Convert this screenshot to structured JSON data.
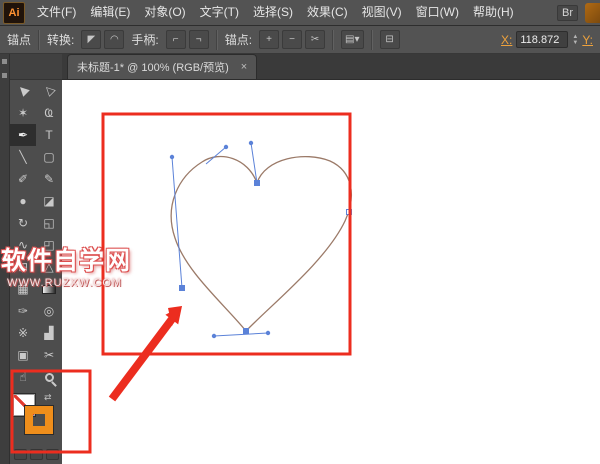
{
  "app": {
    "logo": "Ai",
    "bridge_label": "Br"
  },
  "menubar": {
    "items": [
      {
        "id": "file",
        "label": "文件(F)"
      },
      {
        "id": "edit",
        "label": "编辑(E)"
      },
      {
        "id": "object",
        "label": "对象(O)"
      },
      {
        "id": "type",
        "label": "文字(T)"
      },
      {
        "id": "select",
        "label": "选择(S)"
      },
      {
        "id": "effect",
        "label": "效果(C)"
      },
      {
        "id": "view",
        "label": "视图(V)"
      },
      {
        "id": "window",
        "label": "窗口(W)"
      },
      {
        "id": "help",
        "label": "帮助(H)"
      }
    ]
  },
  "controlbar": {
    "anchor_label": "锚点",
    "convert_label": "转换:",
    "handles_label": "手柄:",
    "anchor_group_label": "锚点:",
    "x_label": "X:",
    "x_value": "118.872",
    "y_label": "Y:"
  },
  "glyphs": {
    "convert_corner": "◤",
    "convert_smooth": "◠",
    "handles_show": "⌐",
    "handles_hide": "¬",
    "add_anchor": "+",
    "remove_anchor": "−",
    "cut_path": "✂",
    "doc_menu": "▤▾",
    "width_profile": "⊟",
    "swap": "⇄",
    "spin_up": "▲",
    "spin_down": "▼"
  },
  "tab": {
    "title": "未标题-1* @ 100% (RGB/预览)",
    "close": "×"
  },
  "toolbar": {
    "tools": [
      {
        "name": "selection-tool",
        "glyph": "▶",
        "rotate": -135
      },
      {
        "name": "direct-selection-tool",
        "glyph": "▷",
        "rotate": -135
      },
      {
        "name": "magic-wand-tool",
        "glyph": "✶"
      },
      {
        "name": "lasso-tool",
        "glyph": "Ҩ"
      },
      {
        "name": "pen-tool",
        "glyph": "✒",
        "active": true
      },
      {
        "name": "type-tool",
        "glyph": "T"
      },
      {
        "name": "line-segment-tool",
        "glyph": "╲"
      },
      {
        "name": "rectangle-tool",
        "glyph": "▢"
      },
      {
        "name": "paintbrush-tool",
        "glyph": "✐"
      },
      {
        "name": "pencil-tool",
        "glyph": "✎"
      },
      {
        "name": "blob-brush-tool",
        "glyph": "●"
      },
      {
        "name": "eraser-tool",
        "glyph": "◪"
      },
      {
        "name": "rotate-tool",
        "glyph": "↻"
      },
      {
        "name": "scale-tool",
        "glyph": "◱"
      },
      {
        "name": "width-tool",
        "glyph": "∿"
      },
      {
        "name": "free-transform-tool",
        "glyph": "◰"
      },
      {
        "name": "shape-builder-tool",
        "glyph": "⊞"
      },
      {
        "name": "perspective-grid-tool",
        "glyph": "△"
      },
      {
        "name": "mesh-tool",
        "glyph": "▦"
      },
      {
        "name": "gradient-tool",
        "chip": "gradient"
      },
      {
        "name": "eyedropper-tool",
        "glyph": "✑"
      },
      {
        "name": "blend-tool",
        "glyph": "◎"
      },
      {
        "name": "symbol-sprayer-tool",
        "glyph": "※"
      },
      {
        "name": "column-graph-tool",
        "glyph": "▟"
      },
      {
        "name": "artboard-tool",
        "glyph": "▣"
      },
      {
        "name": "slice-tool",
        "glyph": "✂"
      },
      {
        "name": "hand-tool",
        "glyph": "☝"
      },
      {
        "name": "zoom-tool",
        "chip": "zoom"
      }
    ]
  },
  "watermark": {
    "line1": "软件自学网",
    "line2": "WWW.RUZXW.COM"
  },
  "colors": {
    "annotation_red": "#ec2d1f",
    "handle_blue": "#5b82d8",
    "heart_stroke": "#9b7a68",
    "stroke_swatch_orange": "#ef8e1b",
    "ui_chrome": "#535353"
  }
}
